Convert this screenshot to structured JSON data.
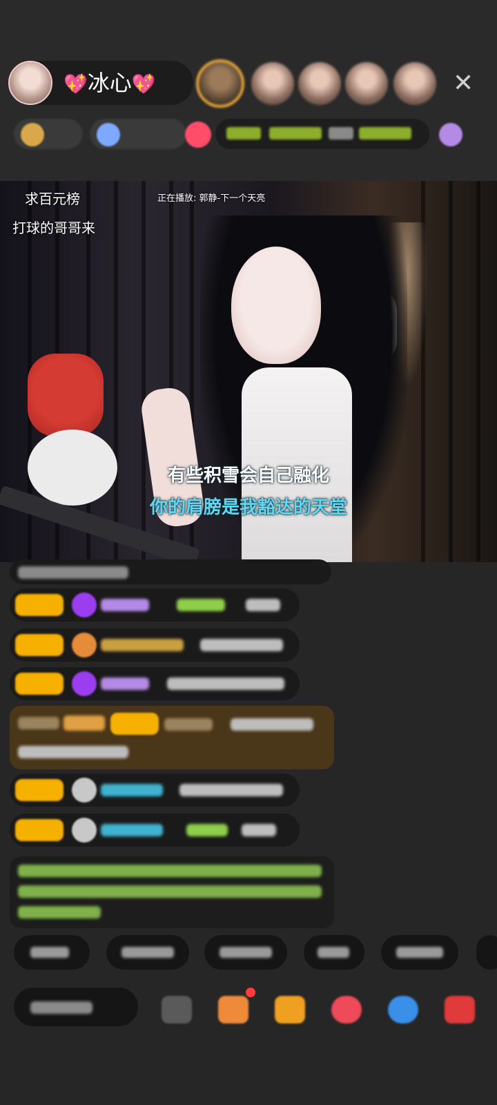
{
  "header": {
    "host_name": "冰心",
    "heart_left": "💖",
    "heart_right": "💖",
    "close_icon": "✕"
  },
  "video": {
    "top_left_line1": "求百元榜",
    "top_left_line2": "打球的哥哥来",
    "now_playing_label": "正在播放:",
    "now_playing_song": "郭静-下一个天亮",
    "lyric_line1": "有些积雪会自己融化",
    "lyric_line2": "你的肩膀是我豁达的天堂"
  },
  "icons": {
    "close": "close-icon",
    "gift": "gift-icon",
    "box": "box-icon",
    "heart": "heart-icon",
    "game": "game-icon",
    "more": "more-icon"
  }
}
